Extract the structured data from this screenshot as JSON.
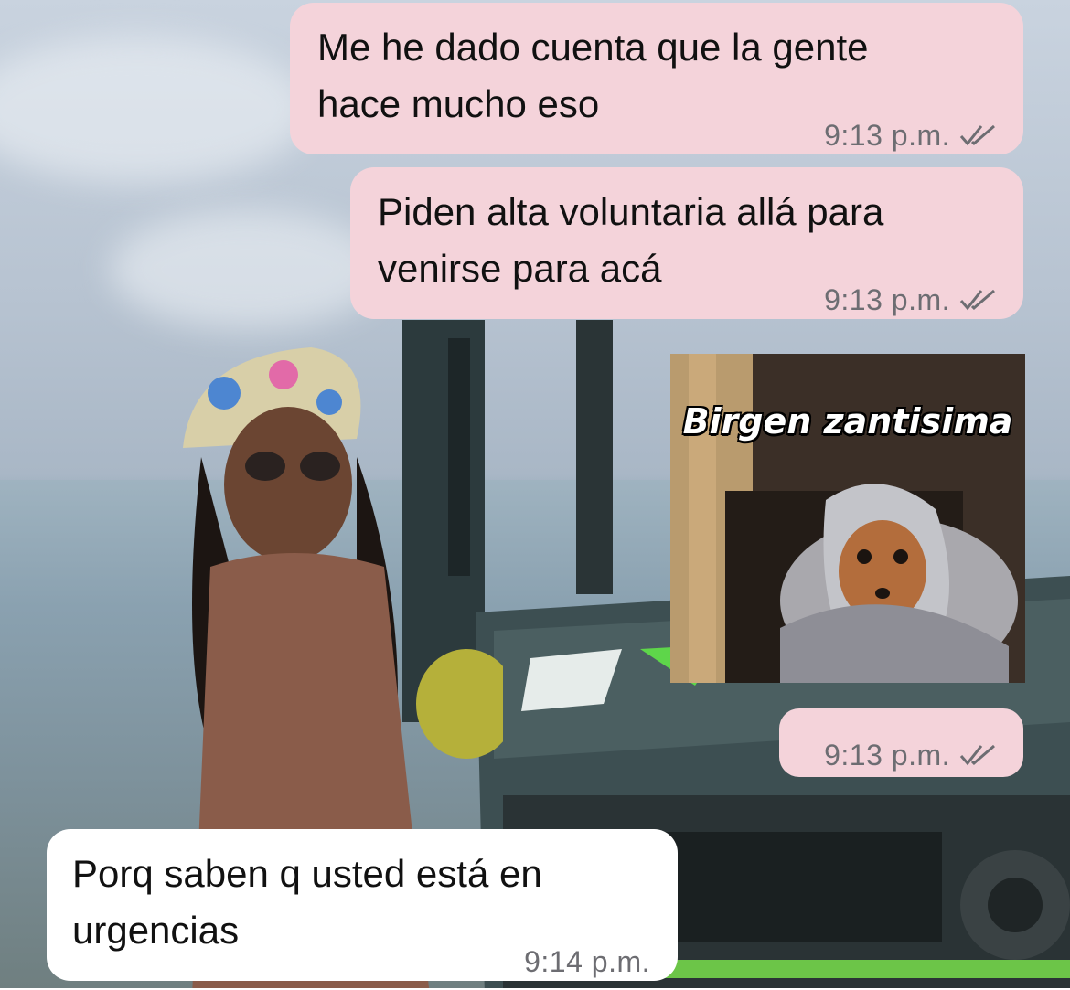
{
  "chat": {
    "messages": [
      {
        "direction": "outgoing",
        "lines": [
          "Me he dado cuenta que la gente",
          "hace mucho eso"
        ],
        "time": "9:13 p.m.",
        "status": "read"
      },
      {
        "direction": "outgoing",
        "lines": [
          "Piden alta voluntaria allá para",
          "venirse para acá"
        ],
        "time": "9:13 p.m.",
        "status": "read"
      },
      {
        "direction": "outgoing",
        "type": "sticker",
        "caption": "Birgen zantisima",
        "time": "9:13 p.m.",
        "status": "read"
      },
      {
        "direction": "incoming",
        "lines": [
          "Porq saben q usted está en",
          "urgencias"
        ],
        "time": "9:14 p.m."
      }
    ]
  },
  "colors": {
    "outgoing_bubble": "#f4d3da",
    "incoming_bubble": "#ffffff",
    "meta_text": "#6d6d72"
  },
  "icons": {
    "read_receipt": "double-check-icon"
  }
}
